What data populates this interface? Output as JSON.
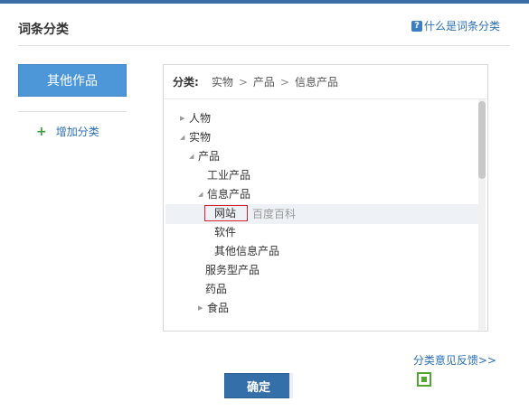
{
  "header": {
    "title": "词条分类",
    "help_icon": "?",
    "help_link": "什么是词条分类"
  },
  "sidebar": {
    "active_category": "其他作品",
    "add_category": "增加分类",
    "add_icon": "+"
  },
  "breadcrumb": {
    "label": "分类:",
    "items": [
      "实物",
      "产品",
      "信息产品"
    ],
    "separator": ">"
  },
  "tree": {
    "nodes": [
      {
        "label": "人物",
        "arrow": "right"
      },
      {
        "label": "实物",
        "arrow": "down"
      },
      {
        "label": "产品",
        "arrow": "down"
      },
      {
        "label": "工业产品",
        "arrow": "none"
      },
      {
        "label": "信息产品",
        "arrow": "down"
      },
      {
        "label": "网站",
        "arrow": "none",
        "selected": true
      },
      {
        "label": "软件",
        "arrow": "none"
      },
      {
        "label": "其他信息产品",
        "arrow": "none"
      },
      {
        "label": "服务型产品",
        "arrow": "none"
      },
      {
        "label": "药品",
        "arrow": "none"
      },
      {
        "label": "食品",
        "arrow": "right"
      }
    ],
    "inline_text": "百度百科"
  },
  "footer": {
    "feedback_link": "分类意见反馈>>",
    "confirm_label": "确定"
  },
  "colors": {
    "accent": "#4d97d9",
    "link": "#2a6fb5",
    "button": "#346fa9",
    "selection_border": "#d8232a"
  }
}
